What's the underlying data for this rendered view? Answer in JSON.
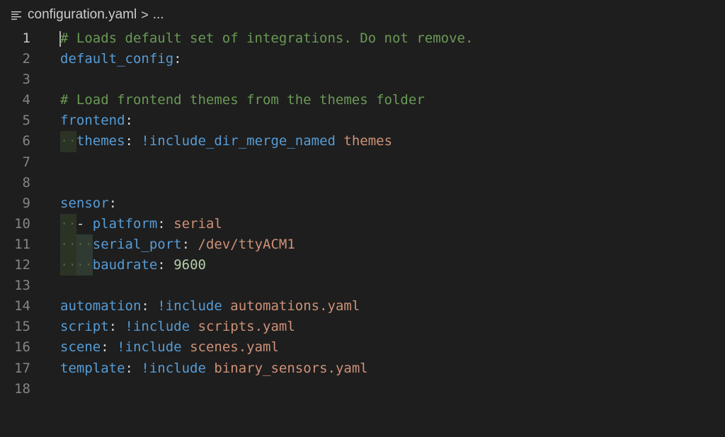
{
  "breadcrumb": {
    "icon": "list-icon",
    "file": "configuration.yaml",
    "separator": ">",
    "more": "..."
  },
  "editor": {
    "current_line": 1,
    "lines": [
      {
        "n": "1",
        "tokens": [
          {
            "c": "c",
            "t": "# Loads default set of integrations. Do not remove."
          }
        ]
      },
      {
        "n": "2",
        "tokens": [
          {
            "c": "k",
            "t": "default_config"
          },
          {
            "c": "p",
            "t": ":"
          }
        ]
      },
      {
        "n": "3",
        "tokens": []
      },
      {
        "n": "4",
        "tokens": [
          {
            "c": "c",
            "t": "# Load frontend themes from the themes folder"
          }
        ]
      },
      {
        "n": "5",
        "tokens": [
          {
            "c": "k",
            "t": "frontend"
          },
          {
            "c": "p",
            "t": ":"
          }
        ]
      },
      {
        "n": "6",
        "tokens": [
          {
            "c": "g1",
            "t": "··"
          },
          {
            "c": "k",
            "t": "themes"
          },
          {
            "c": "p",
            "t": ": "
          },
          {
            "c": "k",
            "t": "!include_dir_merge_named"
          },
          {
            "c": "p",
            "t": " "
          },
          {
            "c": "s",
            "t": "themes"
          }
        ]
      },
      {
        "n": "7",
        "tokens": []
      },
      {
        "n": "8",
        "tokens": []
      },
      {
        "n": "9",
        "tokens": [
          {
            "c": "k",
            "t": "sensor"
          },
          {
            "c": "p",
            "t": ":"
          }
        ]
      },
      {
        "n": "10",
        "tokens": [
          {
            "c": "g1",
            "t": "··"
          },
          {
            "c": "p",
            "t": "- "
          },
          {
            "c": "k",
            "t": "platform"
          },
          {
            "c": "p",
            "t": ": "
          },
          {
            "c": "s",
            "t": "serial"
          }
        ]
      },
      {
        "n": "11",
        "tokens": [
          {
            "c": "g1",
            "t": "··"
          },
          {
            "c": "g2",
            "t": "··"
          },
          {
            "c": "k",
            "t": "serial_port"
          },
          {
            "c": "p",
            "t": ": "
          },
          {
            "c": "s",
            "t": "/dev/ttyACM1"
          }
        ]
      },
      {
        "n": "12",
        "tokens": [
          {
            "c": "g1",
            "t": "··"
          },
          {
            "c": "g2",
            "t": "··"
          },
          {
            "c": "k",
            "t": "baudrate"
          },
          {
            "c": "p",
            "t": ": "
          },
          {
            "c": "n",
            "t": "9600"
          }
        ]
      },
      {
        "n": "13",
        "tokens": []
      },
      {
        "n": "14",
        "tokens": [
          {
            "c": "k",
            "t": "automation"
          },
          {
            "c": "p",
            "t": ": "
          },
          {
            "c": "k",
            "t": "!include"
          },
          {
            "c": "p",
            "t": " "
          },
          {
            "c": "s",
            "t": "automations.yaml"
          }
        ]
      },
      {
        "n": "15",
        "tokens": [
          {
            "c": "k",
            "t": "script"
          },
          {
            "c": "p",
            "t": ": "
          },
          {
            "c": "k",
            "t": "!include"
          },
          {
            "c": "p",
            "t": " "
          },
          {
            "c": "s",
            "t": "scripts.yaml"
          }
        ]
      },
      {
        "n": "16",
        "tokens": [
          {
            "c": "k",
            "t": "scene"
          },
          {
            "c": "p",
            "t": ": "
          },
          {
            "c": "k",
            "t": "!include"
          },
          {
            "c": "p",
            "t": " "
          },
          {
            "c": "s",
            "t": "scenes.yaml"
          }
        ]
      },
      {
        "n": "17",
        "tokens": [
          {
            "c": "k",
            "t": "template"
          },
          {
            "c": "p",
            "t": ": "
          },
          {
            "c": "k",
            "t": "!include"
          },
          {
            "c": "p",
            "t": " "
          },
          {
            "c": "s",
            "t": "binary_sensors.yaml"
          }
        ]
      },
      {
        "n": "18",
        "tokens": []
      }
    ]
  }
}
